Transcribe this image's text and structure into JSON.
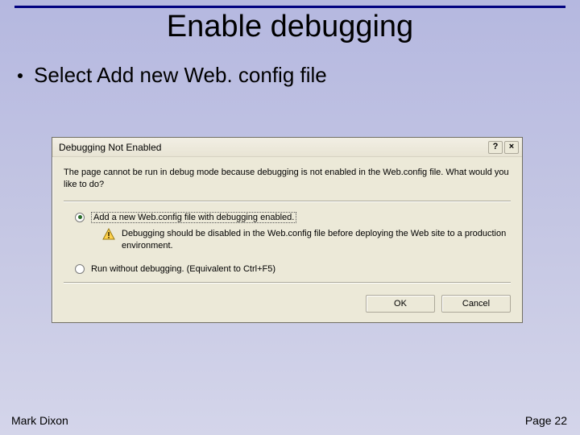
{
  "slide": {
    "title": "Enable debugging",
    "bullet": "Select Add new Web. config file",
    "author": "Mark Dixon",
    "page_label": "Page 22"
  },
  "dialog": {
    "title": "Debugging Not Enabled",
    "help_glyph": "?",
    "close_glyph": "×",
    "message": "The page cannot be run in debug mode because debugging is not enabled in the Web.config file. What would you like to do?",
    "option1": "Add a new Web.config file with debugging enabled.",
    "warning": "Debugging should be disabled in the Web.config file before deploying the Web site to a production environment.",
    "option2": "Run without debugging. (Equivalent to Ctrl+F5)",
    "ok": "OK",
    "cancel": "Cancel"
  }
}
